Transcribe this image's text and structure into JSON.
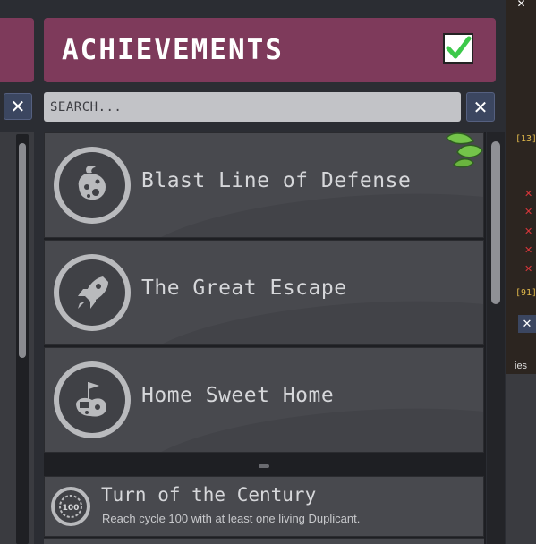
{
  "header": {
    "title": "ACHIEVEMENTS",
    "accent_color": "#7e3a5b",
    "checkbox_checked": true
  },
  "search": {
    "placeholder": "SEARCH..."
  },
  "close_glyph": "✕",
  "achievements": [
    {
      "title": "Blast Line of Defense",
      "icon": "asteroid-icon"
    },
    {
      "title": "The Great Escape",
      "icon": "rocket-icon"
    },
    {
      "title": "Home Sweet Home",
      "icon": "planted-flag-icon"
    }
  ],
  "achievement_small": {
    "title": "Turn of the Century",
    "description": "Reach cycle 100 with at least one living Duplicant.",
    "icon_label": "100"
  },
  "right_strip": {
    "text_1": "[13]",
    "text_2": "[91]",
    "text_3": "ies"
  }
}
